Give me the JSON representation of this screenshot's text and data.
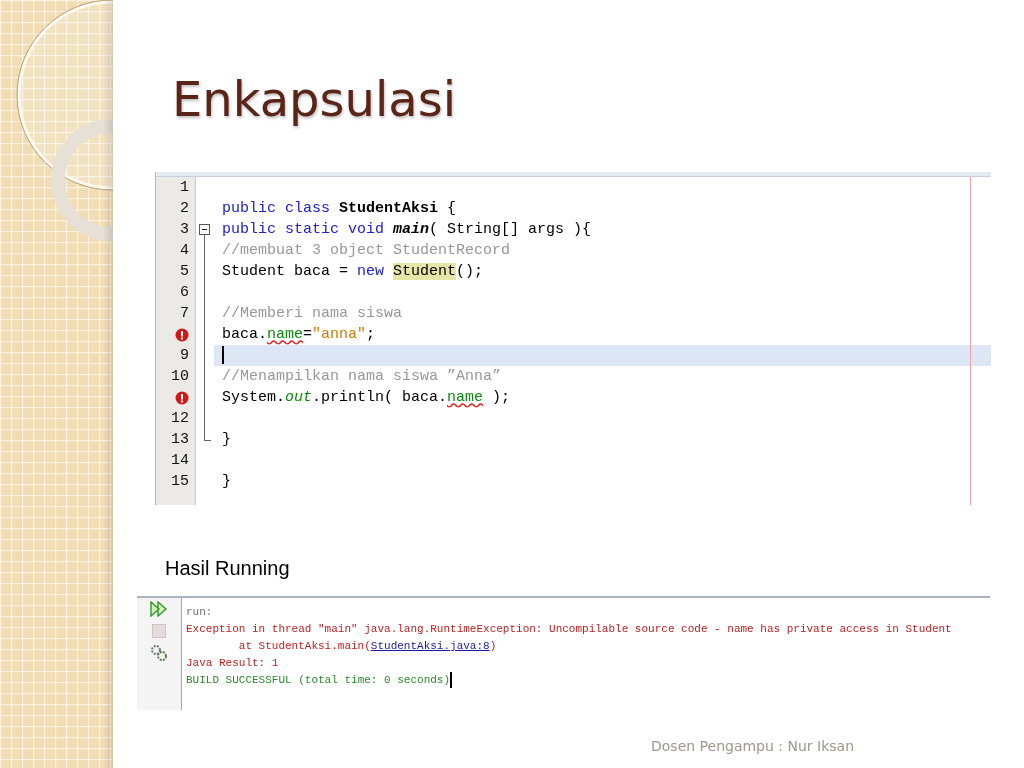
{
  "title": "Enkapsulasi",
  "editor": {
    "lines": [
      {
        "kind": "number",
        "number": "1",
        "fold_start": false,
        "fold_end": false,
        "current": false
      },
      {
        "kind": "number",
        "number": "2",
        "fold_start": false,
        "fold_end": false,
        "current": false,
        "tokens": [
          {
            "text": "public class ",
            "kind": "keyword"
          },
          {
            "text": "StudentAksi",
            "kind": "bold"
          },
          {
            "text": " {",
            "kind": "plain"
          }
        ]
      },
      {
        "kind": "number",
        "number": "3",
        "fold_start": true,
        "fold_end": false,
        "current": false,
        "tokens": [
          {
            "text": "public static void ",
            "kind": "keyword"
          },
          {
            "text": "main",
            "kind": "method"
          },
          {
            "text": "( String[] args ){",
            "kind": "plain"
          }
        ]
      },
      {
        "kind": "number",
        "number": "4",
        "fold_start": false,
        "fold_end": false,
        "current": false,
        "tokens": [
          {
            "text": "//membuat 3 object StudentRecord",
            "kind": "comment"
          }
        ]
      },
      {
        "kind": "number",
        "number": "5",
        "fold_start": false,
        "fold_end": false,
        "current": false,
        "tokens": [
          {
            "text": "Student baca = ",
            "kind": "plain"
          },
          {
            "text": "new ",
            "kind": "keyword"
          },
          {
            "text": "Student",
            "kind": "highlight"
          },
          {
            "text": "();",
            "kind": "plain"
          }
        ]
      },
      {
        "kind": "number",
        "number": "6",
        "fold_start": false,
        "fold_end": false,
        "current": false
      },
      {
        "kind": "number",
        "number": "7",
        "fold_start": false,
        "fold_end": false,
        "current": false,
        "tokens": [
          {
            "text": "//Memberi nama siswa",
            "kind": "comment"
          }
        ]
      },
      {
        "kind": "error",
        "fold_start": false,
        "fold_end": false,
        "current": false,
        "tokens": [
          {
            "text": "baca.",
            "kind": "plain"
          },
          {
            "text": "name",
            "kind": "field-error"
          },
          {
            "text": "=",
            "kind": "plain"
          },
          {
            "text": "\"anna\"",
            "kind": "string"
          },
          {
            "text": ";",
            "kind": "plain"
          }
        ]
      },
      {
        "kind": "number",
        "number": "9",
        "fold_start": false,
        "fold_end": false,
        "current": true
      },
      {
        "kind": "number",
        "number": "10",
        "fold_start": false,
        "fold_end": false,
        "current": false,
        "tokens": [
          {
            "text": "//Menampilkan nama siswa ”Anna”",
            "kind": "comment"
          }
        ]
      },
      {
        "kind": "error",
        "fold_start": false,
        "fold_end": false,
        "current": false,
        "tokens": [
          {
            "text": "System.",
            "kind": "plain"
          },
          {
            "text": "out",
            "kind": "static"
          },
          {
            "text": ".println( baca.",
            "kind": "plain"
          },
          {
            "text": "name",
            "kind": "field-error"
          },
          {
            "text": " );",
            "kind": "plain"
          }
        ]
      },
      {
        "kind": "number",
        "number": "12",
        "fold_start": false,
        "fold_end": false,
        "current": false
      },
      {
        "kind": "number",
        "number": "13",
        "fold_start": false,
        "fold_end": true,
        "current": false,
        "tokens": [
          {
            "text": "}",
            "kind": "plain"
          }
        ]
      },
      {
        "kind": "number",
        "number": "14",
        "fold_start": false,
        "fold_end": false,
        "current": false
      },
      {
        "kind": "number",
        "number": "15",
        "fold_start": false,
        "fold_end": false,
        "current": false,
        "tokens": [
          {
            "text": "}",
            "kind": "plain"
          }
        ]
      }
    ]
  },
  "output_heading": "Hasil Running",
  "console": {
    "toolbar": [
      {
        "kind": "rerun",
        "disabled": false
      },
      {
        "kind": "stop",
        "disabled": true
      },
      {
        "kind": "options",
        "disabled": false
      }
    ],
    "lines": [
      {
        "caret": false,
        "tokens": [
          {
            "text": "run:",
            "kind": "info"
          }
        ]
      },
      {
        "caret": false,
        "tokens": [
          {
            "text": "Exception in thread \"main\" java.lang.RuntimeException: Uncompilable source code - name has private access in Student",
            "kind": "error"
          }
        ]
      },
      {
        "caret": false,
        "tokens": [
          {
            "text": "at StudentAksi.main(",
            "kind": "trace"
          },
          {
            "text": "StudentAksi.java:8",
            "kind": "link"
          },
          {
            "text": ")",
            "kind": "error"
          }
        ]
      },
      {
        "caret": false,
        "tokens": [
          {
            "text": "Java Result: 1",
            "kind": "error"
          }
        ]
      },
      {
        "caret": true,
        "tokens": [
          {
            "text": "BUILD SUCCESSFUL (total time: 0 seconds)",
            "kind": "success"
          }
        ]
      }
    ]
  },
  "footer": "Dosen Pengampu : Nur Iksan"
}
